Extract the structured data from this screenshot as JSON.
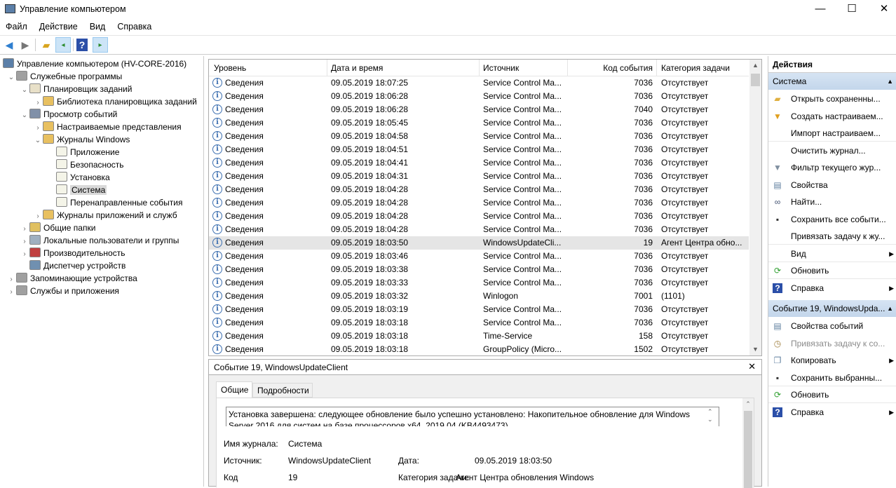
{
  "window": {
    "title": "Управление компьютером",
    "minimize": "—",
    "maximize": "☐",
    "close": "✕"
  },
  "menu": [
    "Файл",
    "Действие",
    "Вид",
    "Справка"
  ],
  "tree": [
    {
      "label": "Управление компьютером (HV-CORE-2016)",
      "level": 0,
      "chevron": "",
      "icon": "computer"
    },
    {
      "label": "Служебные программы",
      "level": 1,
      "chevron": "⌄",
      "icon": "tools"
    },
    {
      "label": "Планировщик заданий",
      "level": 2,
      "chevron": "⌄",
      "icon": "clock"
    },
    {
      "label": "Библиотека планировщика заданий",
      "level": 3,
      "chevron": "›",
      "icon": "folder"
    },
    {
      "label": "Просмотр событий",
      "level": 2,
      "chevron": "⌄",
      "icon": "event-viewer"
    },
    {
      "label": "Настраиваемые представления",
      "level": 3,
      "chevron": "›",
      "icon": "folder"
    },
    {
      "label": "Журналы Windows",
      "level": 3,
      "chevron": "⌄",
      "icon": "folder"
    },
    {
      "label": "Приложение",
      "level": 4,
      "chevron": "",
      "icon": "log"
    },
    {
      "label": "Безопасность",
      "level": 4,
      "chevron": "",
      "icon": "log"
    },
    {
      "label": "Установка",
      "level": 4,
      "chevron": "",
      "icon": "log"
    },
    {
      "label": "Система",
      "level": 4,
      "chevron": "",
      "icon": "log",
      "selected": true
    },
    {
      "label": "Перенаправленные события",
      "level": 4,
      "chevron": "",
      "icon": "log"
    },
    {
      "label": "Журналы приложений и служб",
      "level": 3,
      "chevron": "›",
      "icon": "folder"
    },
    {
      "label": "Общие папки",
      "level": 2,
      "chevron": "›",
      "icon": "shared-folder"
    },
    {
      "label": "Локальные пользователи и группы",
      "level": 2,
      "chevron": "›",
      "icon": "users"
    },
    {
      "label": "Производительность",
      "level": 2,
      "chevron": "›",
      "icon": "performance"
    },
    {
      "label": "Диспетчер устройств",
      "level": 2,
      "chevron": "",
      "icon": "device"
    },
    {
      "label": "Запоминающие устройства",
      "level": 1,
      "chevron": "›",
      "icon": "storage"
    },
    {
      "label": "Службы и приложения",
      "level": 1,
      "chevron": "›",
      "icon": "services"
    }
  ],
  "table": {
    "columns": [
      "Уровень",
      "Дата и время",
      "Источник",
      "Код события",
      "Категория задачи"
    ],
    "rows": [
      [
        "Сведения",
        "09.05.2019 18:07:25",
        "Service Control Ma...",
        "7036",
        "Отсутствует"
      ],
      [
        "Сведения",
        "09.05.2019 18:06:28",
        "Service Control Ma...",
        "7036",
        "Отсутствует"
      ],
      [
        "Сведения",
        "09.05.2019 18:06:28",
        "Service Control Ma...",
        "7040",
        "Отсутствует"
      ],
      [
        "Сведения",
        "09.05.2019 18:05:45",
        "Service Control Ma...",
        "7036",
        "Отсутствует"
      ],
      [
        "Сведения",
        "09.05.2019 18:04:58",
        "Service Control Ma...",
        "7036",
        "Отсутствует"
      ],
      [
        "Сведения",
        "09.05.2019 18:04:51",
        "Service Control Ma...",
        "7036",
        "Отсутствует"
      ],
      [
        "Сведения",
        "09.05.2019 18:04:41",
        "Service Control Ma...",
        "7036",
        "Отсутствует"
      ],
      [
        "Сведения",
        "09.05.2019 18:04:31",
        "Service Control Ma...",
        "7036",
        "Отсутствует"
      ],
      [
        "Сведения",
        "09.05.2019 18:04:28",
        "Service Control Ma...",
        "7036",
        "Отсутствует"
      ],
      [
        "Сведения",
        "09.05.2019 18:04:28",
        "Service Control Ma...",
        "7036",
        "Отсутствует"
      ],
      [
        "Сведения",
        "09.05.2019 18:04:28",
        "Service Control Ma...",
        "7036",
        "Отсутствует"
      ],
      [
        "Сведения",
        "09.05.2019 18:04:28",
        "Service Control Ma...",
        "7036",
        "Отсутствует"
      ],
      [
        "Сведения",
        "09.05.2019 18:03:50",
        "WindowsUpdateCli...",
        "19",
        "Агент Центра обно..."
      ],
      [
        "Сведения",
        "09.05.2019 18:03:46",
        "Service Control Ma...",
        "7036",
        "Отсутствует"
      ],
      [
        "Сведения",
        "09.05.2019 18:03:38",
        "Service Control Ma...",
        "7036",
        "Отсутствует"
      ],
      [
        "Сведения",
        "09.05.2019 18:03:33",
        "Service Control Ma...",
        "7036",
        "Отсутствует"
      ],
      [
        "Сведения",
        "09.05.2019 18:03:32",
        "Winlogon",
        "7001",
        "(1101)"
      ],
      [
        "Сведения",
        "09.05.2019 18:03:19",
        "Service Control Ma...",
        "7036",
        "Отсутствует"
      ],
      [
        "Сведения",
        "09.05.2019 18:03:18",
        "Service Control Ma...",
        "7036",
        "Отсутствует"
      ],
      [
        "Сведения",
        "09.05.2019 18:03:18",
        "Time-Service",
        "158",
        "Отсутствует"
      ],
      [
        "Сведения",
        "09.05.2019 18:03:18",
        "GroupPolicy (Micro...",
        "1502",
        "Отсутствует"
      ]
    ],
    "selected_index": 12
  },
  "detail": {
    "title": "Событие 19, WindowsUpdateClient",
    "close": "✕",
    "tabs": [
      "Общие",
      "Подробности"
    ],
    "active_tab": "Общие",
    "message": "Установка завершена: следующее обновление было успешно установлено: Накопительное обновление для Windows Server 2016 для систем на базе процессоров x64, 2019 04 (KB4493473)",
    "fields": {
      "log_name_label": "Имя журнала:",
      "log_name": "Система",
      "source_label": "Источник:",
      "source": "WindowsUpdateClient",
      "date_label": "Дата:",
      "date": "09.05.2019 18:03:50",
      "code_label": "Код",
      "code": "19",
      "category_label": "Категория задачи:",
      "category": "Агент Центра обновления Windows"
    }
  },
  "actions": {
    "title": "Действия",
    "sections": [
      {
        "header": "Система",
        "items": [
          {
            "label": "Открыть сохраненны...",
            "icon": "open-folder"
          },
          {
            "label": "Создать настраиваем...",
            "icon": "filter-new"
          },
          {
            "label": "Импорт настраиваем...",
            "icon": ""
          },
          {
            "label": "Очистить журнал...",
            "icon": ""
          },
          {
            "label": "Фильтр текущего жур...",
            "icon": "filter"
          },
          {
            "label": "Свойства",
            "icon": "properties"
          },
          {
            "label": "Найти...",
            "icon": "binoculars"
          },
          {
            "label": "Сохранить все событи...",
            "icon": "save"
          },
          {
            "label": "Привязать задачу к жу...",
            "icon": ""
          },
          {
            "label": "Вид",
            "icon": "",
            "submenu": true
          },
          {
            "label": "Обновить",
            "icon": "refresh"
          },
          {
            "label": "Справка",
            "icon": "help",
            "submenu": true
          }
        ]
      },
      {
        "header": "Событие 19, WindowsUpda...",
        "items": [
          {
            "label": "Свойства событий",
            "icon": "properties"
          },
          {
            "label": "Привязать задачу к со...",
            "icon": "task",
            "disabled": true
          },
          {
            "label": "Копировать",
            "icon": "copy",
            "submenu": true
          },
          {
            "label": "Сохранить выбранны...",
            "icon": "save"
          },
          {
            "label": "Обновить",
            "icon": "refresh"
          },
          {
            "label": "Справка",
            "icon": "help",
            "submenu": true
          }
        ]
      }
    ]
  }
}
